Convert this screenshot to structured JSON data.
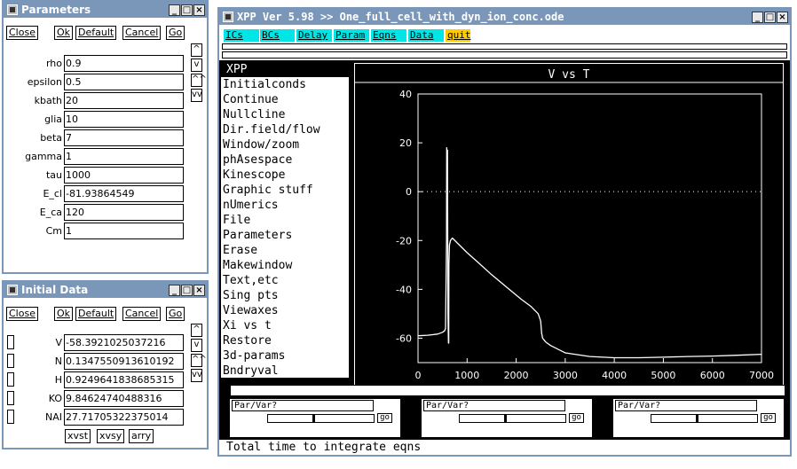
{
  "parameters": {
    "title": "Parameters",
    "buttons": [
      "Close",
      "Ok",
      "Default",
      "Cancel",
      "Go"
    ],
    "scroll": [
      "^",
      "v",
      "^^",
      "vv"
    ],
    "rows": [
      {
        "label": "rho",
        "value": "0.9"
      },
      {
        "label": "epsilon",
        "value": "0.5"
      },
      {
        "label": "kbath",
        "value": "20"
      },
      {
        "label": "glia",
        "value": "10"
      },
      {
        "label": "beta",
        "value": "7"
      },
      {
        "label": "gamma",
        "value": "1"
      },
      {
        "label": "tau",
        "value": "1000"
      },
      {
        "label": "E_cl",
        "value": "-81.93864549"
      },
      {
        "label": "E_ca",
        "value": "120"
      },
      {
        "label": "Cm",
        "value": "1"
      }
    ]
  },
  "initial_data": {
    "title": "Initial Data",
    "buttons": [
      "Close",
      "Ok",
      "Default",
      "Cancel",
      "Go"
    ],
    "scroll": [
      "^",
      "v",
      "^^",
      "vv"
    ],
    "rows": [
      {
        "label": "V",
        "value": "-58.3921025037216"
      },
      {
        "label": "N",
        "value": "0.1347550913610192"
      },
      {
        "label": "H",
        "value": "0.9249641838685315"
      },
      {
        "label": "KO",
        "value": "9.84624740488316"
      },
      {
        "label": "NAI",
        "value": "27.71705322375014"
      }
    ],
    "bottom_buttons": [
      "xvst",
      "xvsy",
      "arry"
    ]
  },
  "xpp": {
    "title": "XPP Ver 5.98 >> One_full_cell_with_dyn_ion_conc.ode",
    "toolbar": [
      "ICs",
      "BCs",
      "Delay",
      "Param",
      "Eqns",
      "Data",
      "quit"
    ],
    "menu_header": "XPP",
    "menu": [
      "Initialconds",
      "Continue",
      "Nullcline",
      "Dir.field/flow",
      "Window/zoom",
      "phAsespace",
      "Kinescope",
      "Graphic stuff",
      "nUmerics",
      "File",
      "Parameters",
      "Erase",
      "Makewindow",
      "Text,etc",
      "Sing pts",
      "Viewaxes",
      "Xi vs t",
      "Restore",
      "3d-params",
      "Bndryval"
    ],
    "sliders": [
      {
        "label": "Par/Var?",
        "go": "go"
      },
      {
        "label": "Par/Var?",
        "go": "go"
      },
      {
        "label": "Par/Var?",
        "go": "go"
      }
    ],
    "status": "Total time to integrate eqns"
  },
  "chart_data": {
    "type": "line",
    "title": "V vs T",
    "xlabel": "",
    "ylabel": "",
    "xlim": [
      0,
      7000
    ],
    "ylim": [
      -70,
      40
    ],
    "xticks": [
      0,
      1000,
      2000,
      3000,
      4000,
      5000,
      6000,
      7000
    ],
    "yticks": [
      40,
      20,
      0,
      -20,
      -40,
      -60
    ],
    "zero_line": true,
    "colors": {
      "background": "#000000",
      "line": "#ffffff"
    },
    "series": [
      {
        "x": [
          0,
          200,
          400,
          500,
          540,
          560,
          580,
          585,
          590,
          600,
          610,
          620,
          625,
          630,
          640,
          660,
          700,
          800,
          1000,
          1200,
          1500,
          1800,
          2100,
          2300,
          2450,
          2500,
          2520,
          2540,
          2560,
          2580,
          2600,
          2700,
          3000,
          3500,
          4000,
          4500,
          5000,
          5500,
          6000,
          6500,
          7000
        ],
        "y": [
          -59,
          -58.8,
          -58.3,
          -57.6,
          -57,
          -56,
          -20,
          18,
          5,
          17,
          -50,
          -62,
          -62,
          -30,
          -22,
          -20,
          -19,
          -21,
          -25,
          -28.5,
          -34,
          -39,
          -44,
          -47,
          -50,
          -53,
          -58,
          -60,
          -60.5,
          -61,
          -61.5,
          -63,
          -66,
          -67.5,
          -68,
          -68,
          -67.8,
          -67.5,
          -67.3,
          -67,
          -66.6
        ]
      }
    ]
  }
}
